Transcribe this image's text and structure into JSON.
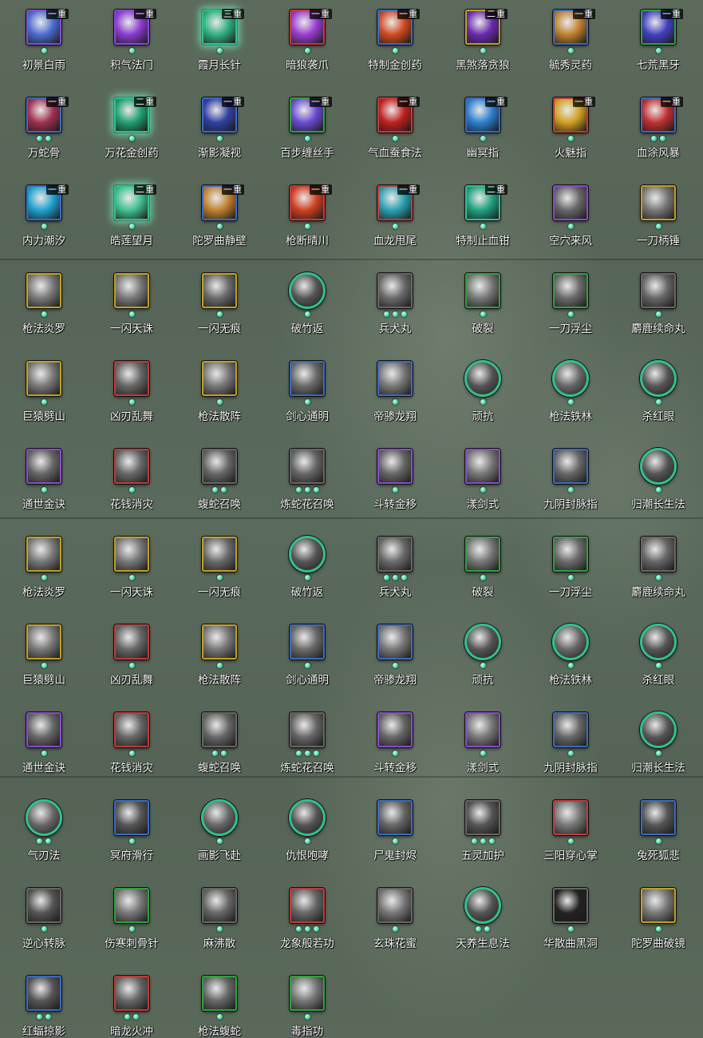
{
  "skills": [
    {
      "name": "初景白雨",
      "badge": "一重",
      "dots": 1,
      "frame": "#8a4ad0",
      "shape": "square",
      "glow": false,
      "art": "#4a6cd0"
    },
    {
      "name": "积气法门",
      "badge": "一重",
      "dots": 1,
      "frame": "#8a4ad0",
      "shape": "square",
      "glow": false,
      "art": "#8a3cd0"
    },
    {
      "name": "霞月长针",
      "badge": "三重",
      "dots": 1,
      "frame": "#30c090",
      "shape": "square",
      "glow": true,
      "art": "#30b080"
    },
    {
      "name": "暗狼袭爪",
      "badge": "一重",
      "dots": 1,
      "frame": "#c03a3a",
      "shape": "square",
      "glow": false,
      "art": "#9a3cd0"
    },
    {
      "name": "特制金创药",
      "badge": "一重",
      "dots": 1,
      "frame": "#3a6ac0",
      "shape": "square",
      "glow": false,
      "art": "#d04a20"
    },
    {
      "name": "黑煞落贪狼",
      "badge": "二重",
      "dots": 1,
      "frame": "#c0a020",
      "shape": "square",
      "glow": false,
      "art": "#6a2ab0"
    },
    {
      "name": "毓秀灵药",
      "badge": "一重",
      "dots": 1,
      "frame": "#3a6ac0",
      "shape": "square",
      "glow": false,
      "art": "#c08030"
    },
    {
      "name": "七荒黑牙",
      "badge": "一重",
      "dots": 1,
      "frame": "#30a040",
      "shape": "square",
      "glow": false,
      "art": "#4040c0"
    },
    {
      "name": "万蛇骨",
      "badge": "一重",
      "dots": 2,
      "frame": "#3a6ac0",
      "shape": "square",
      "glow": false,
      "art": "#a03050"
    },
    {
      "name": "万花金创药",
      "badge": "二重",
      "dots": 1,
      "frame": "#30c090",
      "shape": "square",
      "glow": true,
      "art": "#20a070"
    },
    {
      "name": "渐影凝视",
      "badge": "一重",
      "dots": 1,
      "frame": "#3a6ac0",
      "shape": "square",
      "glow": false,
      "art": "#3040a0"
    },
    {
      "name": "百步缠丝手",
      "badge": "一重",
      "dots": 1,
      "frame": "#30a040",
      "shape": "square",
      "glow": false,
      "art": "#6a4ad0"
    },
    {
      "name": "气血蚕食法",
      "badge": "一重",
      "dots": 1,
      "frame": "#c03a3a",
      "shape": "square",
      "glow": false,
      "art": "#c02020"
    },
    {
      "name": "幽冥指",
      "badge": "一重",
      "dots": 1,
      "frame": "#3a6ac0",
      "shape": "square",
      "glow": false,
      "art": "#2a80d0"
    },
    {
      "name": "火魅指",
      "badge": "一重",
      "dots": 1,
      "frame": "#c03a3a",
      "shape": "square",
      "glow": false,
      "art": "#d0a020"
    },
    {
      "name": "血涂风暴",
      "badge": "一重",
      "dots": 2,
      "frame": "#3a6ac0",
      "shape": "square",
      "glow": false,
      "art": "#c03030"
    },
    {
      "name": "内力潮汐",
      "badge": "一重",
      "dots": 1,
      "frame": "#3a6ac0",
      "shape": "square",
      "glow": false,
      "art": "#20a0d0"
    },
    {
      "name": "皓莲望月",
      "badge": "二重",
      "dots": 1,
      "frame": "#30c090",
      "shape": "square",
      "glow": true,
      "art": "#40c090"
    },
    {
      "name": "陀罗曲静壁",
      "badge": "一重",
      "dots": 1,
      "frame": "#3a6ac0",
      "shape": "square",
      "glow": false,
      "art": "#c08030"
    },
    {
      "name": "枪断晴川",
      "badge": "一重",
      "dots": 1,
      "frame": "#c03a3a",
      "shape": "square",
      "glow": false,
      "art": "#d04020"
    },
    {
      "name": "血龙甩尾",
      "badge": "一重",
      "dots": 1,
      "frame": "#c03a3a",
      "shape": "square",
      "glow": false,
      "art": "#2aa0b0"
    },
    {
      "name": "特制止血钳",
      "badge": "二重",
      "dots": 1,
      "frame": "#30c090",
      "shape": "square",
      "glow": false,
      "art": "#20a080"
    },
    {
      "name": "空穴来风",
      "badge": "",
      "dots": 1,
      "frame": "#8a4ad0",
      "shape": "square",
      "glow": false,
      "art": "#666"
    },
    {
      "name": "一刀柄锤",
      "badge": "",
      "dots": 1,
      "frame": "#c0a020",
      "shape": "square",
      "glow": false,
      "art": "#777"
    },
    {
      "name": "枪法炎罗",
      "badge": "",
      "dots": 1,
      "frame": "#c0a020",
      "shape": "square",
      "glow": false,
      "art": "#777"
    },
    {
      "name": "一闪天诛",
      "badge": "",
      "dots": 1,
      "frame": "#c0a020",
      "shape": "square",
      "glow": false,
      "art": "#777"
    },
    {
      "name": "一闪无痕",
      "badge": "",
      "dots": 1,
      "frame": "#c0a020",
      "shape": "square",
      "glow": false,
      "art": "#6a6a6a"
    },
    {
      "name": "破竹返",
      "badge": "",
      "dots": 1,
      "frame": "#30c090",
      "shape": "round",
      "glow": false,
      "art": "#555"
    },
    {
      "name": "兵犬丸",
      "badge": "",
      "dots": 3,
      "frame": "#666",
      "shape": "square",
      "glow": false,
      "art": "#6a6a6a"
    },
    {
      "name": "破裂",
      "badge": "",
      "dots": 1,
      "frame": "#30a040",
      "shape": "square",
      "glow": false,
      "art": "#777"
    },
    {
      "name": "一刀浮尘",
      "badge": "",
      "dots": 1,
      "frame": "#30a040",
      "shape": "square",
      "glow": false,
      "art": "#6a6a6a"
    },
    {
      "name": "麝鹿续命丸",
      "badge": "",
      "dots": 1,
      "frame": "#666",
      "shape": "square",
      "glow": false,
      "art": "#666"
    },
    {
      "name": "巨猿劈山",
      "badge": "",
      "dots": 1,
      "frame": "#c0a020",
      "shape": "square",
      "glow": false,
      "art": "#777"
    },
    {
      "name": "凶刃乱舞",
      "badge": "",
      "dots": 1,
      "frame": "#c03a3a",
      "shape": "square",
      "glow": false,
      "art": "#666"
    },
    {
      "name": "枪法散阵",
      "badge": "",
      "dots": 1,
      "frame": "#c0a020",
      "shape": "square",
      "glow": false,
      "art": "#777"
    },
    {
      "name": "剑心通明",
      "badge": "",
      "dots": 1,
      "frame": "#3a6ac0",
      "shape": "square",
      "glow": false,
      "art": "#6a6a6a"
    },
    {
      "name": "帝骖龙翔",
      "badge": "",
      "dots": 1,
      "frame": "#3a6ac0",
      "shape": "square",
      "glow": false,
      "art": "#777"
    },
    {
      "name": "顽抗",
      "badge": "",
      "dots": 1,
      "frame": "#30c090",
      "shape": "round",
      "glow": false,
      "art": "#555"
    },
    {
      "name": "枪法铁林",
      "badge": "",
      "dots": 1,
      "frame": "#30c090",
      "shape": "round",
      "glow": false,
      "art": "#666"
    },
    {
      "name": "杀红眼",
      "badge": "",
      "dots": 1,
      "frame": "#30c090",
      "shape": "round",
      "glow": false,
      "art": "#555"
    },
    {
      "name": "通世金诀",
      "badge": "",
      "dots": 1,
      "frame": "#8a4ad0",
      "shape": "square",
      "glow": false,
      "art": "#666"
    },
    {
      "name": "花钱消灾",
      "badge": "",
      "dots": 1,
      "frame": "#c03a3a",
      "shape": "square",
      "glow": false,
      "art": "#666"
    },
    {
      "name": "蝮蛇召唤",
      "badge": "",
      "dots": 2,
      "frame": "#666",
      "shape": "square",
      "glow": false,
      "art": "#666"
    },
    {
      "name": "炼蛇花召唤",
      "badge": "",
      "dots": 3,
      "frame": "#666",
      "shape": "square",
      "glow": false,
      "art": "#666"
    },
    {
      "name": "斗转金移",
      "badge": "",
      "dots": 1,
      "frame": "#8a4ad0",
      "shape": "square",
      "glow": false,
      "art": "#666"
    },
    {
      "name": "漾剑式",
      "badge": "",
      "dots": 1,
      "frame": "#8a4ad0",
      "shape": "square",
      "glow": false,
      "art": "#777"
    },
    {
      "name": "九阴封脉指",
      "badge": "",
      "dots": 1,
      "frame": "#3a6ac0",
      "shape": "square",
      "glow": false,
      "art": "#666"
    },
    {
      "name": "归潮长生法",
      "badge": "",
      "dots": 1,
      "frame": "#30c090",
      "shape": "round",
      "glow": false,
      "art": "#555"
    },
    {
      "name": "枪法炎罗",
      "badge": "",
      "dots": 1,
      "frame": "#c0a020",
      "shape": "square",
      "glow": false,
      "art": "#777"
    },
    {
      "name": "一闪天诛",
      "badge": "",
      "dots": 1,
      "frame": "#c0a020",
      "shape": "square",
      "glow": false,
      "art": "#777"
    },
    {
      "name": "一闪无痕",
      "badge": "",
      "dots": 1,
      "frame": "#c0a020",
      "shape": "square",
      "glow": false,
      "art": "#6a6a6a"
    },
    {
      "name": "破竹返",
      "badge": "",
      "dots": 1,
      "frame": "#30c090",
      "shape": "round",
      "glow": false,
      "art": "#555"
    },
    {
      "name": "兵犬丸",
      "badge": "",
      "dots": 3,
      "frame": "#666",
      "shape": "square",
      "glow": false,
      "art": "#6a6a6a"
    },
    {
      "name": "破裂",
      "badge": "",
      "dots": 1,
      "frame": "#30a040",
      "shape": "square",
      "glow": false,
      "art": "#777"
    },
    {
      "name": "一刀浮尘",
      "badge": "",
      "dots": 1,
      "frame": "#30a040",
      "shape": "square",
      "glow": false,
      "art": "#6a6a6a"
    },
    {
      "name": "麝鹿续命丸",
      "badge": "",
      "dots": 1,
      "frame": "#666",
      "shape": "square",
      "glow": false,
      "art": "#666"
    },
    {
      "name": "巨猿劈山",
      "badge": "",
      "dots": 1,
      "frame": "#c0a020",
      "shape": "square",
      "glow": false,
      "art": "#777"
    },
    {
      "name": "凶刃乱舞",
      "badge": "",
      "dots": 1,
      "frame": "#c03a3a",
      "shape": "square",
      "glow": false,
      "art": "#666"
    },
    {
      "name": "枪法散阵",
      "badge": "",
      "dots": 1,
      "frame": "#c0a020",
      "shape": "square",
      "glow": false,
      "art": "#777"
    },
    {
      "name": "剑心通明",
      "badge": "",
      "dots": 1,
      "frame": "#3a6ac0",
      "shape": "square",
      "glow": false,
      "art": "#6a6a6a"
    },
    {
      "name": "帝骖龙翔",
      "badge": "",
      "dots": 1,
      "frame": "#3a6ac0",
      "shape": "square",
      "glow": false,
      "art": "#777"
    },
    {
      "name": "顽抗",
      "badge": "",
      "dots": 1,
      "frame": "#30c090",
      "shape": "round",
      "glow": false,
      "art": "#555"
    },
    {
      "name": "枪法铁林",
      "badge": "",
      "dots": 1,
      "frame": "#30c090",
      "shape": "round",
      "glow": false,
      "art": "#666"
    },
    {
      "name": "杀红眼",
      "badge": "",
      "dots": 1,
      "frame": "#30c090",
      "shape": "round",
      "glow": false,
      "art": "#555"
    },
    {
      "name": "通世金诀",
      "badge": "",
      "dots": 1,
      "frame": "#8a4ad0",
      "shape": "square",
      "glow": false,
      "art": "#666"
    },
    {
      "name": "花钱消灾",
      "badge": "",
      "dots": 1,
      "frame": "#c03a3a",
      "shape": "square",
      "glow": false,
      "art": "#666"
    },
    {
      "name": "蝮蛇召唤",
      "badge": "",
      "dots": 2,
      "frame": "#666",
      "shape": "square",
      "glow": false,
      "art": "#666"
    },
    {
      "name": "炼蛇花召唤",
      "badge": "",
      "dots": 3,
      "frame": "#666",
      "shape": "square",
      "glow": false,
      "art": "#666"
    },
    {
      "name": "斗转金移",
      "badge": "",
      "dots": 1,
      "frame": "#8a4ad0",
      "shape": "square",
      "glow": false,
      "art": "#666"
    },
    {
      "name": "漾剑式",
      "badge": "",
      "dots": 1,
      "frame": "#8a4ad0",
      "shape": "square",
      "glow": false,
      "art": "#777"
    },
    {
      "name": "九阴封脉指",
      "badge": "",
      "dots": 1,
      "frame": "#3a6ac0",
      "shape": "square",
      "glow": false,
      "art": "#666"
    },
    {
      "name": "归潮长生法",
      "badge": "",
      "dots": 1,
      "frame": "#30c090",
      "shape": "round",
      "glow": false,
      "art": "#555"
    },
    {
      "name": "气刃法",
      "badge": "",
      "dots": 2,
      "frame": "#30c090",
      "shape": "round",
      "glow": false,
      "art": "#666"
    },
    {
      "name": "冥府滑行",
      "badge": "",
      "dots": 1,
      "frame": "#3a6ac0",
      "shape": "square",
      "glow": false,
      "art": "#555"
    },
    {
      "name": "画影飞赴",
      "badge": "",
      "dots": 1,
      "frame": "#30c090",
      "shape": "round",
      "glow": false,
      "art": "#666"
    },
    {
      "name": "仇恨咆哮",
      "badge": "",
      "dots": 1,
      "frame": "#30c090",
      "shape": "round",
      "glow": false,
      "art": "#555"
    },
    {
      "name": "尸鬼封烬",
      "badge": "",
      "dots": 1,
      "frame": "#3a6ac0",
      "shape": "square",
      "glow": false,
      "art": "#666"
    },
    {
      "name": "五灵加护",
      "badge": "",
      "dots": 3,
      "frame": "#666",
      "shape": "square",
      "glow": false,
      "art": "#555"
    },
    {
      "name": "三阳穿心掌",
      "badge": "",
      "dots": 1,
      "frame": "#c03a3a",
      "shape": "square",
      "glow": false,
      "art": "#777"
    },
    {
      "name": "兔死狐悲",
      "badge": "",
      "dots": 1,
      "frame": "#3a6ac0",
      "shape": "square",
      "glow": false,
      "art": "#555"
    },
    {
      "name": "逆心转脉",
      "badge": "",
      "dots": 1,
      "frame": "#666",
      "shape": "square",
      "glow": false,
      "art": "#555"
    },
    {
      "name": "伤寒刺骨针",
      "badge": "",
      "dots": 1,
      "frame": "#30a040",
      "shape": "square",
      "glow": false,
      "art": "#777"
    },
    {
      "name": "麻沸散",
      "badge": "",
      "dots": 1,
      "frame": "#666",
      "shape": "square",
      "glow": false,
      "art": "#666"
    },
    {
      "name": "龙象般若功",
      "badge": "",
      "dots": 3,
      "frame": "#c03a3a",
      "shape": "square",
      "glow": false,
      "art": "#666"
    },
    {
      "name": "玄珠花蜜",
      "badge": "",
      "dots": 1,
      "frame": "#666",
      "shape": "square",
      "glow": false,
      "art": "#777"
    },
    {
      "name": "天养生息法",
      "badge": "",
      "dots": 2,
      "frame": "#30c090",
      "shape": "round",
      "glow": false,
      "art": "#555"
    },
    {
      "name": "华散曲黑洞",
      "badge": "",
      "dots": 1,
      "frame": "#666",
      "shape": "square",
      "glow": false,
      "art": "#222"
    },
    {
      "name": "陀罗曲破镜",
      "badge": "",
      "dots": 1,
      "frame": "#c0a020",
      "shape": "square",
      "glow": false,
      "art": "#777"
    },
    {
      "name": "红蝠掠影",
      "badge": "",
      "dots": 2,
      "frame": "#3a6ac0",
      "shape": "square",
      "glow": false,
      "art": "#555"
    },
    {
      "name": "暗龙火冲",
      "badge": "",
      "dots": 2,
      "frame": "#c03a3a",
      "shape": "square",
      "glow": false,
      "art": "#666"
    },
    {
      "name": "枪法蝮蛇",
      "badge": "",
      "dots": 1,
      "frame": "#30a040",
      "shape": "square",
      "glow": false,
      "art": "#666"
    },
    {
      "name": "毒指功",
      "badge": "",
      "dots": 1,
      "frame": "#30a040",
      "shape": "square",
      "glow": false,
      "art": "#777"
    }
  ]
}
